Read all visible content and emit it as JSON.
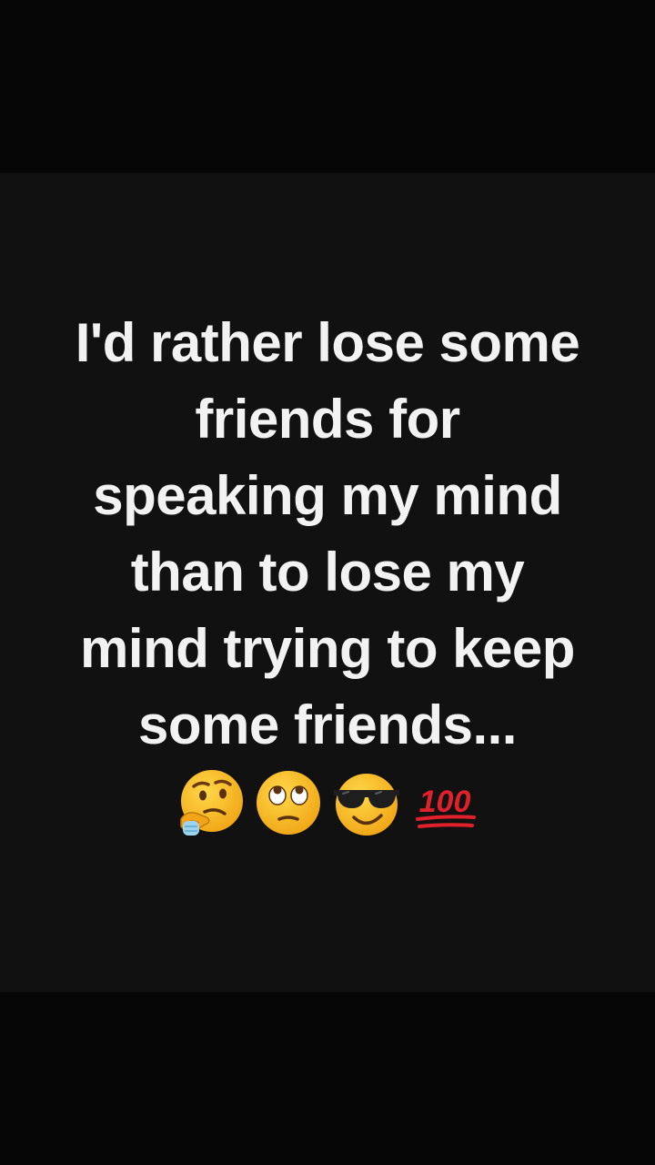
{
  "quote": {
    "lines": [
      "I'd rather lose some",
      "friends for",
      "speaking my mind",
      "than to lose my",
      "mind trying to keep",
      "some friends..."
    ]
  },
  "emojis": [
    {
      "name": "thinking-face-icon"
    },
    {
      "name": "eye-roll-face-icon"
    },
    {
      "name": "sunglasses-face-icon"
    },
    {
      "name": "hundred-points-icon",
      "text": "100"
    }
  ],
  "colors": {
    "background": "#050505",
    "card": "#111111",
    "text": "#f2f2f2",
    "emoji_yellow": "#f7b81f",
    "hundred_red": "#e0202a"
  }
}
